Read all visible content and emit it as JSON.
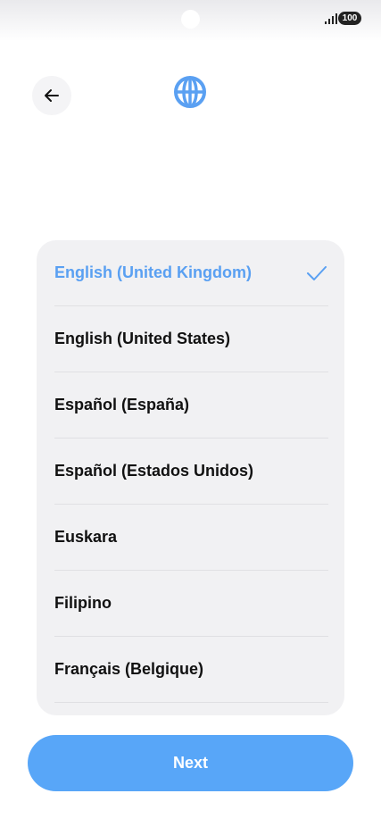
{
  "status_bar": {
    "battery_level": "100",
    "icons": [
      "camera-cutout",
      "signal-icon",
      "battery-icon"
    ]
  },
  "header": {
    "back_icon": "arrow-left-icon",
    "globe_icon": "globe-icon"
  },
  "language_list": {
    "selected_index": 0,
    "items": [
      {
        "label": "English (United Kingdom)",
        "selected": true
      },
      {
        "label": "English (United States)",
        "selected": false
      },
      {
        "label": "Español (España)",
        "selected": false
      },
      {
        "label": "Español (Estados Unidos)",
        "selected": false
      },
      {
        "label": "Euskara",
        "selected": false
      },
      {
        "label": "Filipino",
        "selected": false
      },
      {
        "label": "Français (Belgique)",
        "selected": false
      }
    ]
  },
  "footer": {
    "next_label": "Next"
  },
  "colors": {
    "accent": "#5aa0f2",
    "button": "#58a6f8",
    "card_background": "#f1f1f3"
  }
}
